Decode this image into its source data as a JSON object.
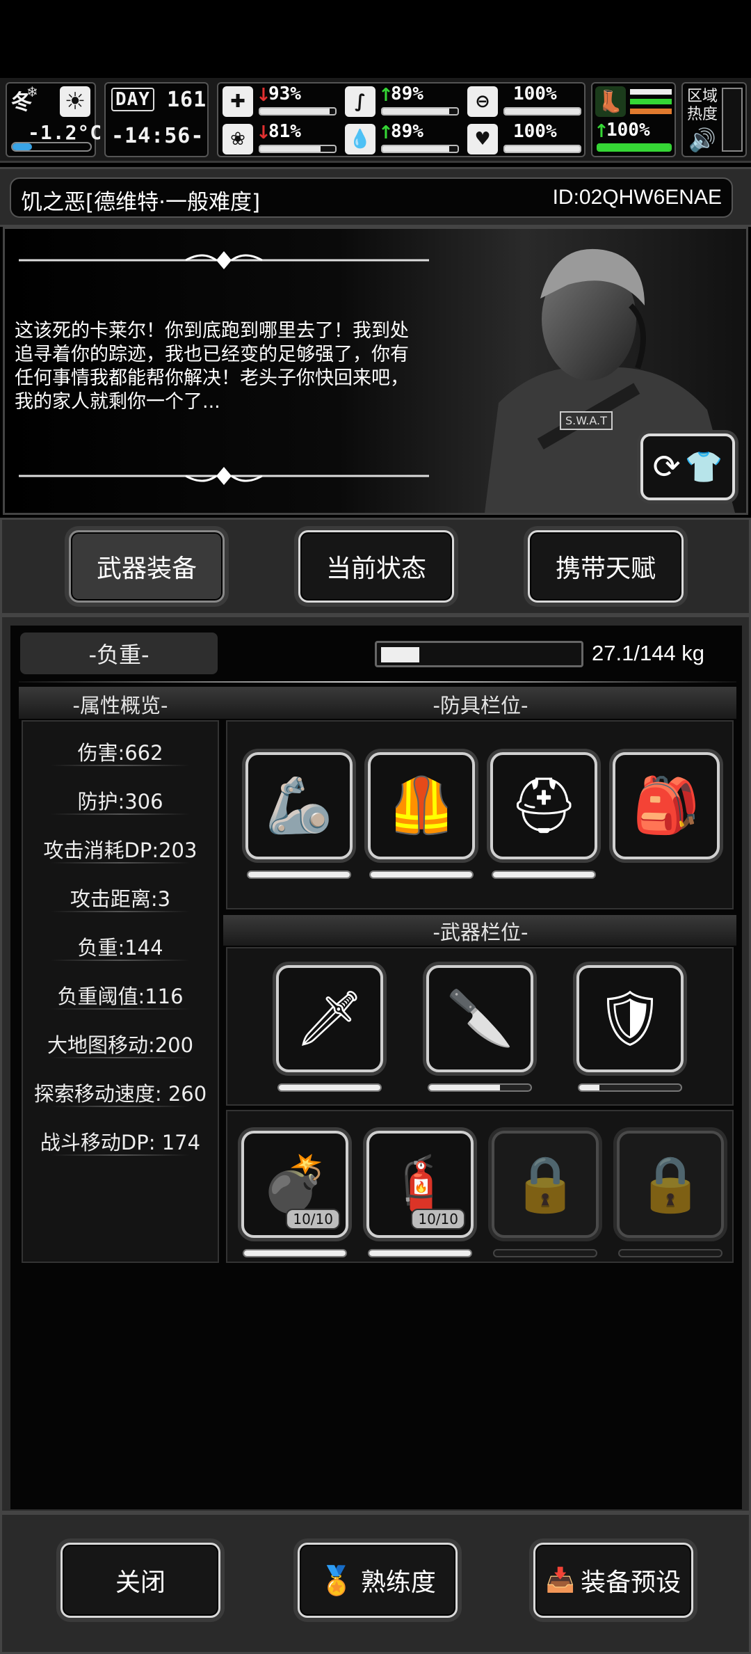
{
  "hud": {
    "season": "冬",
    "temperature": "-1.2°C",
    "day_label": "DAY",
    "day_number": "161",
    "clock": "-14:56-",
    "stats": [
      {
        "name": "health",
        "icon": "medkit-icon",
        "trend": "down",
        "value": "93%",
        "level": 0.93
      },
      {
        "name": "hunger",
        "icon": "stomach-icon",
        "trend": "up",
        "value": "89%",
        "level": 0.89
      },
      {
        "name": "stamina",
        "icon": "capsule-icon",
        "trend": "none",
        "value": "100%",
        "level": 1.0
      },
      {
        "name": "mood",
        "icon": "brain-icon",
        "trend": "down",
        "value": "81%",
        "level": 0.81
      },
      {
        "name": "thirst",
        "icon": "water-drop-icon",
        "trend": "up",
        "value": "89%",
        "level": 0.89
      },
      {
        "name": "heart",
        "icon": "heart-icon",
        "trend": "none",
        "value": "100%",
        "level": 1.0
      },
      {
        "name": "move",
        "icon": "boot-icon",
        "trend": "up",
        "value": "100%",
        "level": 1.0
      }
    ],
    "region_label": "区域\n热度",
    "colors": {
      "up": "#35d635",
      "down": "#e03030",
      "boot": "#39e639",
      "stripe_orange": "#e07a2e"
    }
  },
  "header": {
    "title": "饥之恶[德维特·一般难度]",
    "id": "ID:02QHW6ENAE"
  },
  "story": {
    "text": "这该死的卡莱尔！你到底跑到哪里去了！我到处追寻着你的踪迹，我也已经变的足够强了，你有任何事情我都能帮你解决！老头子你快回来吧，我的家人就剩你一个了...",
    "badge": "S.W.A.T"
  },
  "tabs": [
    {
      "label": "武器装备",
      "active": true
    },
    {
      "label": "当前状态",
      "active": false
    },
    {
      "label": "携带天赋",
      "active": false
    }
  ],
  "weight": {
    "label": "-负重-",
    "value": "27.1/144 kg",
    "fraction": 0.19
  },
  "attributes": {
    "title": "-属性概览-",
    "items": [
      "伤害:662",
      "防护:306",
      "攻击消耗DP:203",
      "攻击距离:3",
      "负重:144",
      "负重阈值:116",
      "大地图移动:200",
      "探索移动速度: 260",
      "战斗移动DP: 174"
    ]
  },
  "armor": {
    "title": "-防具栏位-",
    "slots": [
      {
        "name": "arm-guards-icon",
        "durability": 1.0
      },
      {
        "name": "body-armor-icon",
        "durability": 1.0
      },
      {
        "name": "helmet-icon",
        "durability": 1.0
      },
      {
        "name": "backpack-icon",
        "durability": null
      }
    ]
  },
  "weapons": {
    "title": "-武器栏位-",
    "slots": [
      {
        "name": "katana-icon",
        "durability": 1.0
      },
      {
        "name": "knife-icon",
        "durability": 0.7
      },
      {
        "name": "riot-shield-icon",
        "durability": 0.2
      }
    ]
  },
  "items": {
    "slots": [
      {
        "name": "grenade-icon",
        "count": "10/10",
        "durability": 1.0,
        "locked": false
      },
      {
        "name": "gas-canister-icon",
        "count": "10/10",
        "durability": 1.0,
        "locked": false
      },
      {
        "name": "lock-icon",
        "locked": true
      },
      {
        "name": "lock-icon",
        "locked": true
      }
    ]
  },
  "footer": {
    "close": "关闭",
    "proficiency": "熟练度",
    "preset": "装备预设"
  }
}
